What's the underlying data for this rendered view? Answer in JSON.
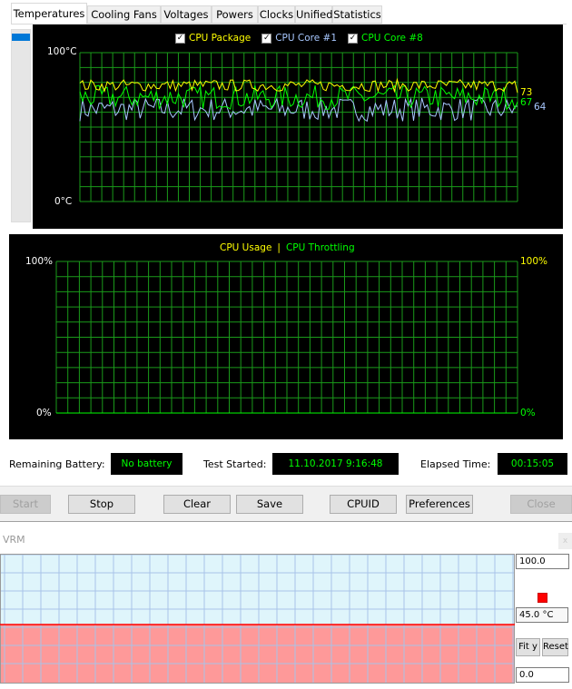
{
  "tabs": [
    "Temperatures",
    "Cooling Fans",
    "Voltages",
    "Powers",
    "Clocks",
    "Unified",
    "Statistics"
  ],
  "temp_chart": {
    "legend": [
      {
        "label": "CPU Package",
        "color": "#ffff00",
        "checked": true,
        "current": 73
      },
      {
        "label": "CPU Core #1",
        "color": "#a8c8ff",
        "checked": true,
        "current": 64
      },
      {
        "label": "CPU Core #8",
        "color": "#00ff00",
        "checked": true,
        "current": 67
      }
    ],
    "ymax_label": "100°C",
    "ymin_label": "0°C",
    "ylim": [
      0,
      100
    ]
  },
  "usage_chart": {
    "legend": [
      {
        "label": "CPU Usage",
        "color": "#ffff00"
      },
      {
        "label": "CPU Throttling",
        "color": "#00ff00"
      }
    ],
    "separator": "|",
    "left_max": "100%",
    "left_min": "0%",
    "right_max": "100%",
    "right_min": "0%"
  },
  "status": {
    "battery_label": "Remaining Battery:",
    "battery_value": "No battery",
    "test_label": "Test Started:",
    "test_value": "11.10.2017 9:16:48",
    "elapsed_label": "Elapsed Time:",
    "elapsed_value": "00:15:05"
  },
  "buttons": {
    "start": "Start",
    "stop": "Stop",
    "clear": "Clear",
    "save": "Save",
    "cpuid": "CPUID",
    "preferences": "Preferences",
    "close": "Close"
  },
  "vrm": {
    "title": "VRM",
    "max": "100.0",
    "threshold": "45.0 °C",
    "min": "0.0",
    "fit_y": "Fit y",
    "reset": "Reset",
    "close": "x",
    "threshold_value": 45,
    "threshold_color": "#ff0000"
  }
}
